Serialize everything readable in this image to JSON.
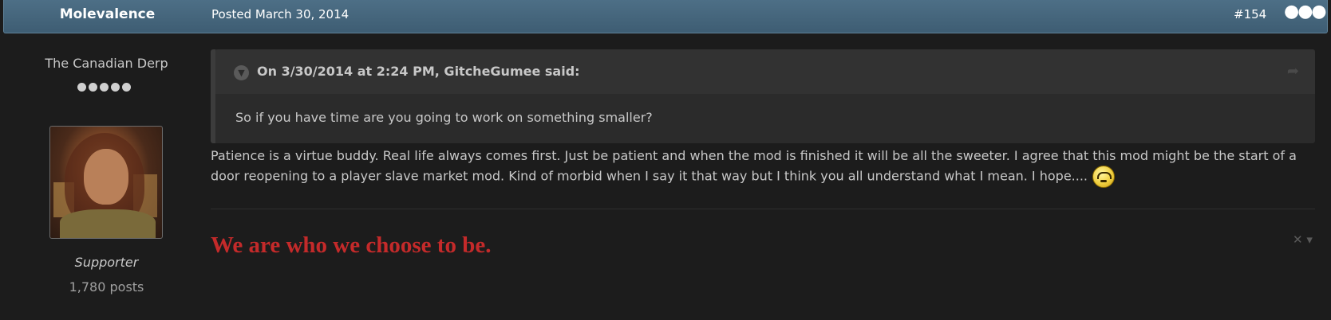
{
  "header": {
    "author_name": "Molevalence",
    "posted": "Posted March 30, 2014",
    "post_number": "#154",
    "menu_icon": "more-dots-icon"
  },
  "author": {
    "title": "The Canadian Derp",
    "rank_pips": 5,
    "role": "Supporter",
    "post_count": "1,780 posts"
  },
  "quote": {
    "citation": "On 3/30/2014 at 2:24 PM, GitcheGumee said:",
    "text": "So if you have time are you going to work on something smaller?"
  },
  "post": {
    "body": "Patience is a virtue buddy. Real life always comes first. Just be patient and when the mod is finished it will be all the sweeter. I agree that this mod might be the start of a door reopening to a player slave market mod. Kind of morbid when I say it that way but I think you all understand what I mean. I hope...."
  },
  "signature": {
    "text": "We are who we choose to be.",
    "color": "#c42a2a"
  },
  "colors": {
    "header_bg": "#46667d",
    "page_bg": "#1c1c1c",
    "quote_bg": "#2b2b2b"
  }
}
